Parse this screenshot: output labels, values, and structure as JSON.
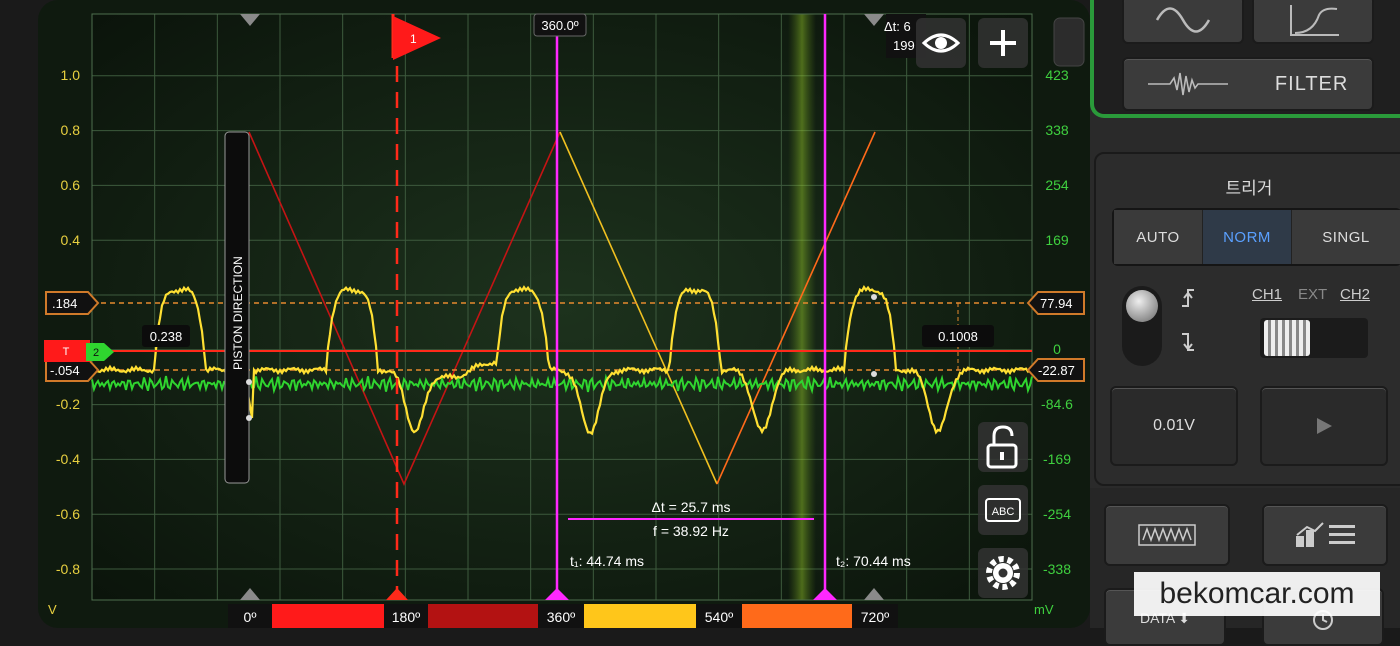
{
  "scope": {
    "left_axis_ticks": [
      "1.0",
      "0.8",
      "0.6",
      "0.4",
      "-0.2",
      "-0.4",
      "-0.6",
      "-0.8"
    ],
    "right_axis_ticks": [
      "423",
      "338",
      "254",
      "169",
      "0",
      "-84.6",
      "-169",
      "-254",
      "-338"
    ],
    "left_unit": "V",
    "right_unit": "mV",
    "trigger_flag_label": "1",
    "cursor_top_label": "360.0º",
    "delta_top_label": "Δt: 6",
    "delta_top_value": "199",
    "ch1_marker_high": ".184",
    "ch1_marker_low": "-.054",
    "ch2_marker_high": "77.94",
    "ch2_marker_low": "-22.87",
    "left_value_label": "0.238",
    "right_value_label": "0.1008",
    "trigger_tag": "T",
    "channel_tag": "2",
    "piston_direction_label": "PISTON DIRECTION",
    "delta_t": "Δt = 25.7 ms",
    "frequency": "f = 38.92 Hz",
    "t1": "t₁: 44.74 ms",
    "t2": "t₂: 70.44 ms",
    "degree_labels": [
      "0º",
      "180º",
      "360º",
      "540º",
      "720º"
    ],
    "abc_label": "ABC",
    "colors": {
      "ch1": "#ffe033",
      "ch2": "#2fd52f",
      "trigger": "#ff2a1a",
      "cursor": "#ff28ff",
      "grid": "#3d5a3d",
      "background": "#0d190d",
      "cycle_180": "#ff1a1a",
      "cycle_360": "#b31212",
      "cycle_540": "#ffc61a",
      "cycle_720": "#ff6a1a"
    }
  },
  "panel": {
    "filter_label": "FILTER",
    "trigger_title": "트리거",
    "trigger_modes": [
      "AUTO",
      "NORM",
      "SINGL"
    ],
    "trigger_mode_selected": "NORM",
    "source_labels": [
      "CH1",
      "EXT",
      "CH2"
    ],
    "level": "0.01V",
    "data_label": "DATA",
    "watermark": "bekomcar.com"
  }
}
